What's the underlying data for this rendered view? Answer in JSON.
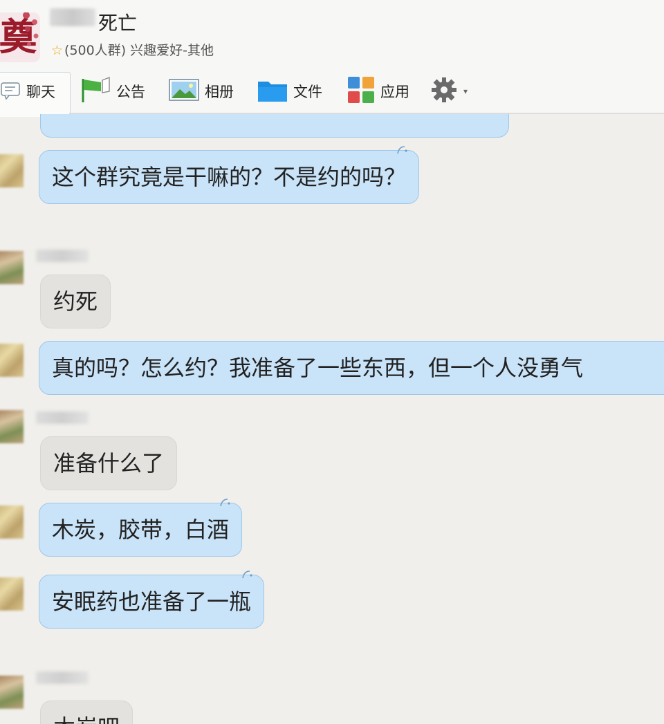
{
  "header": {
    "group_name_suffix": "死亡",
    "group_meta": "(500人群) 兴趣爱好-其他",
    "logo_char": "奠"
  },
  "toolbar": {
    "items": [
      {
        "label": "聊天",
        "icon": "chat-icon"
      },
      {
        "label": "公告",
        "icon": "flag-icon"
      },
      {
        "label": "相册",
        "icon": "photo-album-icon"
      },
      {
        "label": "文件",
        "icon": "folder-icon"
      },
      {
        "label": "应用",
        "icon": "apps-grid-icon"
      }
    ],
    "settings_icon": "gear-icon"
  },
  "chat": {
    "messages": [
      {
        "text": "这个群究竟是干嘛的？不是约的吗？",
        "style": "blue"
      },
      {
        "text": "约死",
        "style": "gray"
      },
      {
        "text": "真的吗？怎么约？我准备了一些东西，但一个人没勇气",
        "style": "blue"
      },
      {
        "text": "准备什么了",
        "style": "gray"
      },
      {
        "text": "木炭，胶带，白酒",
        "style": "blue"
      },
      {
        "text": "安眠药也准备了一瓶",
        "style": "blue"
      },
      {
        "text": "木炭吧",
        "style": "gray"
      }
    ]
  },
  "colors": {
    "bubble_blue": "#c9e3f8",
    "bubble_gray": "#e3e2df",
    "background": "#f0efeb"
  }
}
